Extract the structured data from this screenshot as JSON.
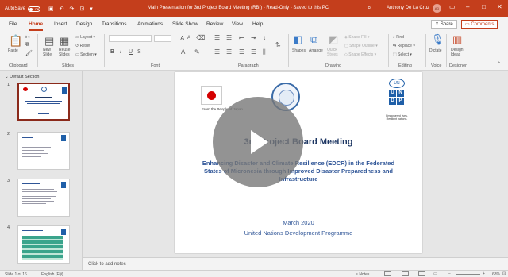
{
  "titlebar": {
    "autosave_label": "AutoSave",
    "autosave_state": "Off",
    "document_title": "Main Presentation for 3rd Project Board Meeting (RBI) - Read-Only - Saved to this PC",
    "search_icon": "search-icon",
    "user_name": "Anthony De La Cruz",
    "avatar_initials": "AD",
    "minimize": "–",
    "restore": "□",
    "close": "✕"
  },
  "tabs": [
    "File",
    "Home",
    "Insert",
    "Design",
    "Transitions",
    "Animations",
    "Slide Show",
    "Review",
    "View",
    "Help"
  ],
  "active_tab": "Home",
  "share_label": "Share",
  "comments_label": "Comments",
  "ribbon": {
    "groups": {
      "clipboard": "Clipboard",
      "slides": "Slides",
      "font": "Font",
      "paragraph": "Paragraph",
      "drawing": "Drawing",
      "editing": "Editing",
      "voice": "Voice",
      "designer": "Designer"
    },
    "paste": "Paste",
    "new_slide": "New Slide",
    "reuse_slides": "Reuse Slides",
    "layout": "Layout",
    "reset": "Reset",
    "section": "Section",
    "font_size_up": "A",
    "font_size_down": "A",
    "bold": "B",
    "italic": "I",
    "underline": "U",
    "strike": "S",
    "shapes": "Shapes",
    "arrange": "Arrange",
    "quick_styles": "Quick Styles",
    "shape_fill": "Shape Fill",
    "shape_outline": "Shape Outline",
    "shape_effects": "Shape Effects",
    "find": "Find",
    "replace": "Replace",
    "select": "Select",
    "dictate": "Dictate",
    "design_ideas": "Design Ideas"
  },
  "pane": {
    "section_label": "Default Section",
    "slides": [
      {
        "num": "1",
        "selected": true
      },
      {
        "num": "2",
        "selected": false
      },
      {
        "num": "3",
        "selected": false
      },
      {
        "num": "4",
        "selected": false
      }
    ]
  },
  "slide": {
    "people_caption": "From the People of Japan",
    "undp_letters": [
      "U",
      "N",
      "D",
      "P"
    ],
    "undp_globe": "UN",
    "undp_caption": "Empowered lives. Resilient nations.",
    "title": "3rd Project Board Meeting",
    "subtitle": "Enhancing Disaster and Climate Resilience (EDCR) in the Federated States of Micronesia through Improved Disaster Preparedness and Infrastructure",
    "date": "March 2020",
    "organization": "United Nations Development Programme"
  },
  "notes_placeholder": "Click to add notes",
  "status": {
    "slide_counter": "Slide 1 of 16",
    "language": "English (Fiji)",
    "notes": "Notes",
    "zoom": "68%"
  }
}
